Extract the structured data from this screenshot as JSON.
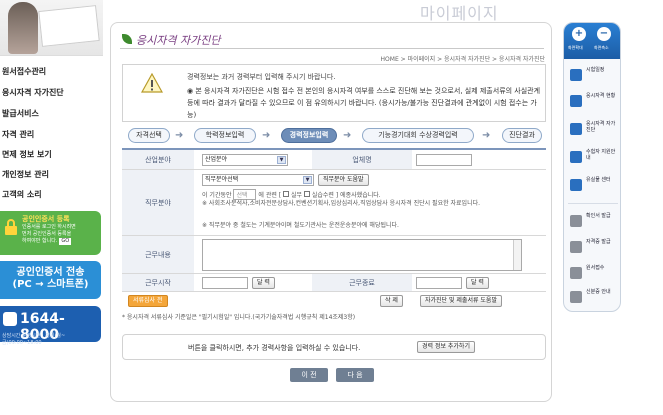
{
  "page_title": "마이페이지",
  "section_title": "응시자격 자가진단",
  "breadcrumb": "HOME > 마이페이지 > 응시자격 자가진단 > 응시자격 자가진단",
  "sidebar": {
    "items": [
      {
        "label": "원서접수관리"
      },
      {
        "label": "응시자격 자가진단"
      },
      {
        "label": "발급서비스"
      },
      {
        "label": "자격 관리"
      },
      {
        "label": "면제 정보 보기"
      },
      {
        "label": "개인정보 관리"
      },
      {
        "label": "고객의 소리"
      }
    ],
    "promo_cert": {
      "title": "공인인증서 등록",
      "line1": "인증서를 로그인 하시려면",
      "line2": "먼저 공인인증서 등록을",
      "line3": "하여야만 합니다.",
      "go": "GO"
    },
    "promo_transfer": {
      "line1": "공인인증서 전송",
      "line2": "(PC → 스마트폰)"
    },
    "callcenter": {
      "number": "1644-8000",
      "hours": "상담시간 운영시간 : 평일(월~금)09:00~18:00"
    }
  },
  "notice": {
    "line1": "경력정보는 과거 경력부터 입력해 주시기 바랍니다.",
    "line2": "◉ 본 응시자격 자가진단은 시험 접수 전 본인의 응시자격 여부를 스스로 진단해 보는 것으로서, 실제 제출서류의 사실관계 등에 따라 결과가 달라질 수 있으므로 이 점 유의하시기 바랍니다. (응시가능/불가능 진단결과에 관계없이 시험 접수는 가능)"
  },
  "steps": [
    {
      "label": "자격선택"
    },
    {
      "label": "학력정보입력"
    },
    {
      "label": "경력정보입력"
    },
    {
      "label": "기능경기대회 수상경력입력"
    },
    {
      "label": "진단결과"
    }
  ],
  "form": {
    "industry_label": "산업분야",
    "industry_value": "산업분야",
    "company_label": "업체명",
    "duty_label": "직무분야",
    "duty_value": "직무분야선택",
    "duty_help_btn": "직무분야 도움말",
    "period_text1": "이 기간동안",
    "period_select": "선택",
    "period_text2": "에 관련 [",
    "period_opt1": "실무",
    "period_opt2": "실습수련",
    "period_text3": "] 에종사했습니다.",
    "note1": "※ 사회조사분석사,소비자전문상담사,컨벤션기획사,임상심리사,직업상담사 응시자격 진단시 필요한 자료입니다.",
    "note2": "※ 직무분야 중 철도는 기계분야이며 철도기관사는 운전운송분야에 해당됩니다.",
    "content_label": "근무내용",
    "start_label": "근무시작",
    "start_btn": "달 력",
    "end_label": "근무종료",
    "end_btn": "달 력",
    "review_btn": "서류심사 전",
    "delete_btn": "삭 제",
    "doc_help_btn": "자가진단 및 제출서류 도움말"
  },
  "footnote": "* 응시자격 서류심사 기준일은 \"필기시험일\" 입니다.(국가기술자격법 시행규칙 제14조제3항)",
  "hint": {
    "text": "버튼을 클릭하시면, 추가 경력사항을 입력하실 수 있습니다.",
    "btn": "경력 정보 추가하기"
  },
  "nav": {
    "prev": "이 전",
    "next": "다 음"
  },
  "quick": {
    "top_left": "화면확대",
    "top_right": "화면축소",
    "items": [
      {
        "label": "시험일정"
      },
      {
        "label": "응시자격 현황"
      },
      {
        "label": "응시자격 자가진단"
      },
      {
        "label": "수험자 지원안내"
      },
      {
        "label": "유실물 센터"
      },
      {
        "label": "확인서 발급"
      },
      {
        "label": "자격증 발급"
      },
      {
        "label": "원서접수"
      },
      {
        "label": "신분증 안내"
      }
    ]
  }
}
